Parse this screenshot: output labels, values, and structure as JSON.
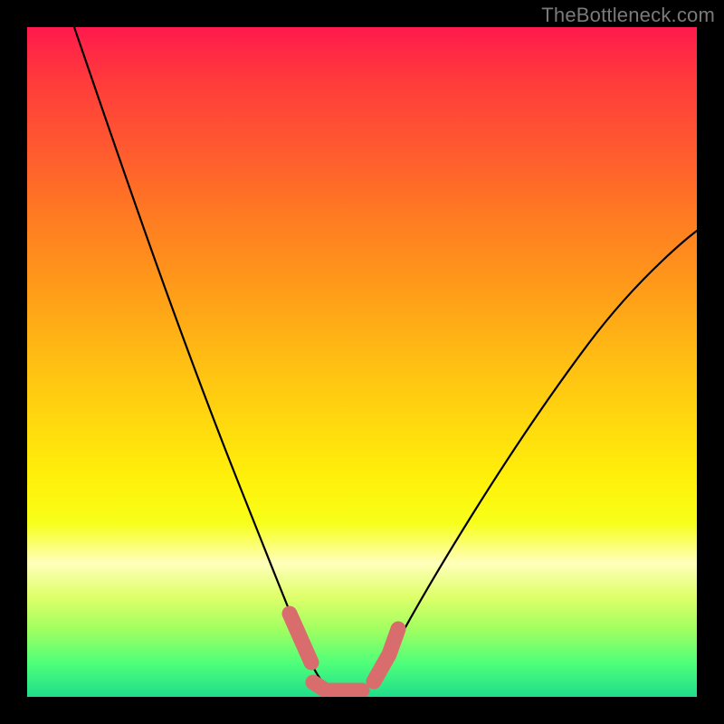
{
  "watermark": "TheBottleneck.com",
  "colors": {
    "frame": "#000000",
    "curve": "#000000",
    "highlight": "#d96d6d",
    "gradient_stops": [
      "#ff1a4d",
      "#ff3b3b",
      "#ff5930",
      "#ff7a22",
      "#ff981a",
      "#ffb814",
      "#ffd60f",
      "#fff20a",
      "#f7ff1a",
      "#ffffbb",
      "#dfff6a",
      "#a0ff60",
      "#4eff7a",
      "#1fdd8a"
    ]
  },
  "chart_data": {
    "type": "line",
    "title": "",
    "xlabel": "",
    "ylabel": "",
    "xlim": [
      0,
      100
    ],
    "ylim": [
      0,
      100
    ],
    "series": [
      {
        "name": "bottleneck_curve",
        "x": [
          7,
          10,
          14,
          18,
          22,
          26,
          30,
          33,
          36,
          38,
          40,
          42,
          44,
          46,
          48,
          50,
          52,
          56,
          60,
          66,
          72,
          80,
          90,
          100
        ],
        "values": [
          100,
          91,
          80,
          70,
          60,
          50,
          40,
          31,
          23,
          17,
          12,
          7,
          4,
          2,
          1,
          1,
          2,
          8,
          16,
          27,
          37,
          48,
          58,
          66
        ]
      }
    ],
    "annotations": {
      "highlight_segment": {
        "description": "thick rounded segment near minimum",
        "points": [
          {
            "x": 39,
            "y": 13
          },
          {
            "x": 42,
            "y": 6
          },
          {
            "x": 44,
            "y": 2
          },
          {
            "x": 48,
            "y": 1
          },
          {
            "x": 51,
            "y": 1
          },
          {
            "x": 53,
            "y": 4
          },
          {
            "x": 55,
            "y": 9
          },
          {
            "x": 56,
            "y": 13
          }
        ]
      }
    }
  }
}
